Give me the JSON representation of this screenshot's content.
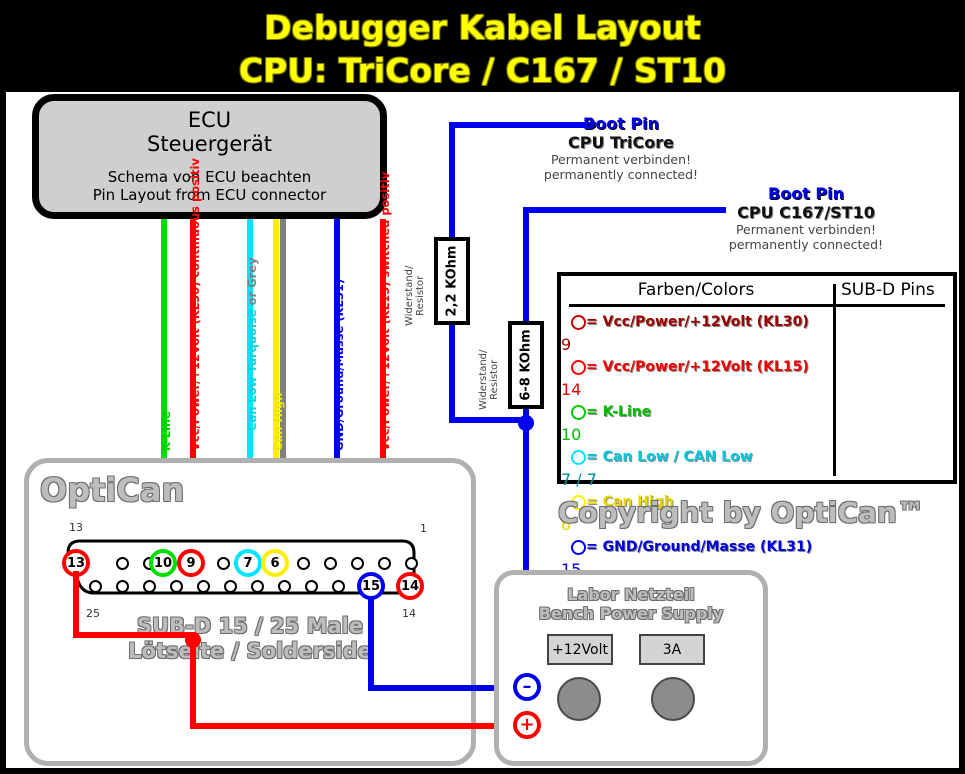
{
  "title": {
    "line1": "Debugger Kabel Layout",
    "line2": "CPU: TriCore / C167 / ST10",
    "color": "#ffff00",
    "background": "#000000"
  },
  "ecu": {
    "line1": "ECU",
    "line2": "Steuergerät",
    "line3": "Schema von ECU beachten",
    "line4": "Pin Layout from ECU connector",
    "fill": "#cfcfcf"
  },
  "wire_labels": [
    {
      "text": "K-Line",
      "color": "#00cc00"
    },
    {
      "text": "Vcc/Power/+12Volt (KL30) continuous positiv",
      "color": "#ff0000"
    },
    {
      "text": "Can Low Turquoise",
      "text2": " or Grey",
      "color": "#00d5e6",
      "color2": "#808080"
    },
    {
      "text": "Can High",
      "color": "#e8e800"
    },
    {
      "text": "GND/Ground/Masse (KL31)",
      "color": "#0000ee"
    },
    {
      "text": "Vcc/Power/+12Volt (KL15) switched positiv",
      "color": "#ff0000"
    }
  ],
  "resistors": [
    {
      "label": "Widerstand/",
      "label2": "Resistor",
      "value": "2,2 KOhm"
    },
    {
      "label": "Widerstand/",
      "label2": "Resistor",
      "value": "6-8 KOhm"
    }
  ],
  "boot_pins": [
    {
      "heading": "Boot Pin",
      "cpu": "CPU TriCore",
      "note_de": "Permanent verbinden!",
      "note_en": "permanently connected!"
    },
    {
      "heading": "Boot Pin",
      "cpu": "CPU C167/ST10",
      "note_de": "Permanent verbinden!",
      "note_en": "permanently connected!"
    }
  ],
  "legend": {
    "header_colors": "Farben/Colors",
    "header_pins": "SUB-D Pins",
    "rows": [
      {
        "ring": "#cc0000",
        "text": "= Vcc/Power/+12Volt (KL30)",
        "color": "#990000",
        "pin": "9"
      },
      {
        "ring": "#ff0000",
        "text": "= Vcc/Power/+12Volt (KL15)",
        "color": "#ee0000",
        "pin": "14"
      },
      {
        "ring": "#00cc00",
        "text": "= K-Line",
        "color": "#00bb00",
        "pin": "10"
      },
      {
        "ring": "#00e5ff",
        "text": "= Can Low / CAN Low",
        "color": "#00c8dd",
        "pin": "7 / 7"
      },
      {
        "ring": "#ffee00",
        "text": "= Can High",
        "color": "#e8d800",
        "pin": "6"
      },
      {
        "ring": "#0000ee",
        "text": "= GND/Ground/Masse (KL31)",
        "color": "#0000dd",
        "pin": "15"
      }
    ]
  },
  "optican": {
    "brand": "OptiCan",
    "caption1": "SUB-D 15 / 25 Male",
    "caption2": "Lötseite / Solderside",
    "corner_pins": {
      "top_left": "13",
      "top_right": "1",
      "bottom_left": "25",
      "bottom_right": "14"
    },
    "marked_pins": [
      {
        "number": "13",
        "color": "#ff0000"
      },
      {
        "number": "10",
        "color": "#00dd00"
      },
      {
        "number": "9",
        "color": "#ff0000"
      },
      {
        "number": "7",
        "color": "#00e5ff"
      },
      {
        "number": "6",
        "color": "#ffee00"
      },
      {
        "number": "15",
        "color": "#0000ee"
      },
      {
        "number": "14",
        "color": "#ff0000"
      }
    ]
  },
  "psu": {
    "title_de": "Labor Netzteil",
    "title_en": "Bench Power Supply",
    "voltage_display": "+12Volt",
    "current_display": "3A",
    "terminal_minus": "–",
    "terminal_plus": "+"
  },
  "copyright": "Copyright by OptiCan™"
}
